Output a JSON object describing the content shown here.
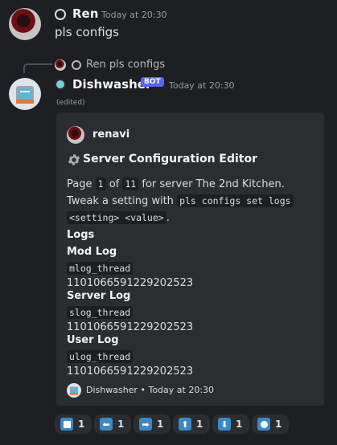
{
  "message1": {
    "author": "Ren",
    "time": "Today at 20:30",
    "text": "pls configs"
  },
  "reply": {
    "author": "Ren",
    "text": "pls configs"
  },
  "message2": {
    "author": "Dishwasher",
    "badge": "BOT",
    "time": "Today at 20:30",
    "edited": "(edited)"
  },
  "embed": {
    "author": "renavi",
    "title": "Server Configuration Editor",
    "desc": {
      "page_label": "Page",
      "page_current": "1",
      "of_label": "of",
      "page_total": "11",
      "server_text": "for server The 2nd Kitchen.",
      "tweak_text": "Tweak a setting with",
      "cmd1": "pls configs set logs",
      "cmd2": "<setting> <value>",
      "period": "."
    },
    "section": "Logs",
    "fields": [
      {
        "title": "Mod Log",
        "key": "mlog_thread",
        "value": "1101066591229202523"
      },
      {
        "title": "Server Log",
        "key": "slog_thread",
        "value": "1101066591229202523"
      },
      {
        "title": "User Log",
        "key": "ulog_thread",
        "value": "1101066591229202523"
      }
    ],
    "footer": {
      "name": "Dishwasher",
      "sep": "•",
      "time": "Today at 20:30"
    }
  },
  "reactions": [
    {
      "icon": "stop-button-icon",
      "count": "1"
    },
    {
      "icon": "arrow-left-icon",
      "count": "1"
    },
    {
      "icon": "arrow-right-icon",
      "count": "1"
    },
    {
      "icon": "arrow-up-icon",
      "count": "1"
    },
    {
      "icon": "arrow-down-icon",
      "count": "1"
    },
    {
      "icon": "record-button-icon",
      "count": "1"
    }
  ],
  "colors": {
    "background": "#1e1f22",
    "embed": "#2b2d31",
    "badge": "#5865f2",
    "emoji_blue": "#3b88c3"
  }
}
